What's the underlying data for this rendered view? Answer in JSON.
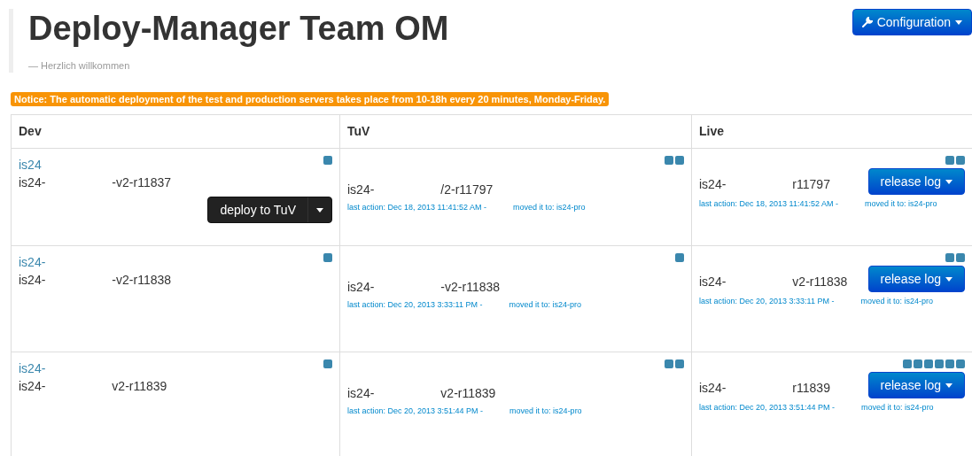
{
  "header": {
    "title": "Deploy-Manager Team OM",
    "subtitle": "— Herzlich willkommen"
  },
  "config_button": {
    "label": "Configuration"
  },
  "notice": "Notice: The automatic deployment of the test and production servers takes place from 10-18h every 20 minutes, Monday-Friday.",
  "table": {
    "columns": [
      "Dev",
      "TuV",
      "Live"
    ],
    "rows": [
      {
        "dev": {
          "link": "is24",
          "name_start": "is24-",
          "name_end": "-v2-r11837",
          "markers": [
            {
              "kind": "square"
            }
          ],
          "button": "deploy to TuV"
        },
        "tuv": {
          "name_start": "is24-",
          "name_end": "/2-r11797",
          "action_start": "last action: Dec 18, 2013 11:41:52 AM -",
          "action_end": "moved it to: is24-pro",
          "markers": [
            {
              "kind": "square"
            },
            {
              "kind": "square"
            }
          ]
        },
        "live": {
          "name_start": "is24-",
          "name_end": "r11797",
          "action_start": "last action: Dec 18, 2013 11:41:52 AM -",
          "action_end": "moved it to: is24-pro",
          "markers": [
            {
              "kind": "square"
            },
            {
              "kind": "square"
            }
          ],
          "button": "release log"
        }
      },
      {
        "dev": {
          "link": "is24-",
          "name_start": "is24-",
          "name_end": "-v2-r11838",
          "markers": [
            {
              "kind": "square"
            }
          ]
        },
        "tuv": {
          "name_start": "is24-",
          "name_end": "-v2-r11838",
          "action_start": "last action: Dec 20, 2013 3:33:11 PM -",
          "action_end": "moved it to: is24-pro",
          "markers": [
            {
              "kind": "square"
            }
          ]
        },
        "live": {
          "name_start": "is24-",
          "name_end": "v2-r11838",
          "action_start": "last action: Dec 20, 2013 3:33:11 PM -",
          "action_end": "moved it to: is24-pro",
          "markers": [
            {
              "kind": "square"
            },
            {
              "kind": "square"
            }
          ],
          "button": "release log"
        }
      },
      {
        "dev": {
          "link": "is24-",
          "name_start": "is24-",
          "name_end": "v2-r11839",
          "markers": [
            {
              "kind": "square"
            }
          ]
        },
        "tuv": {
          "name_start": "is24-",
          "name_end": "v2-r11839",
          "action_start": "last action: Dec 20, 2013 3:51:44 PM -",
          "action_end": "moved it to: is24-pro",
          "markers": [
            {
              "kind": "square"
            },
            {
              "kind": "square"
            }
          ]
        },
        "live": {
          "name_start": "is24-",
          "name_end": "r11839",
          "action_start": "last action: Dec 20, 2013 3:51:44 PM -",
          "action_end": "moved it to: is24-pro",
          "markers": [
            {
              "kind": "square"
            },
            {
              "kind": "square"
            },
            {
              "kind": "square"
            },
            {
              "kind": "square"
            },
            {
              "kind": "square"
            },
            {
              "kind": "square"
            }
          ],
          "button": "release log"
        }
      }
    ]
  }
}
